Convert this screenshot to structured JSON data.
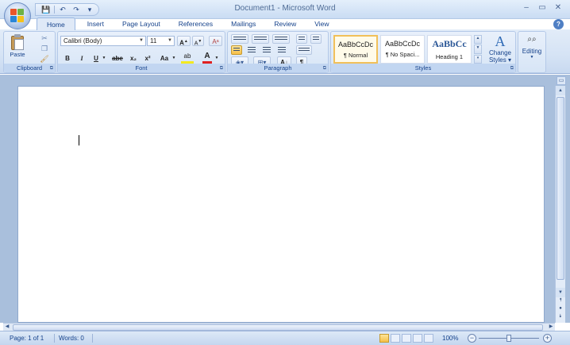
{
  "window": {
    "title": "Document1 - Microsoft Word"
  },
  "qat": {
    "save": "💾",
    "undo": "↶",
    "redo": "↷",
    "more": "▾"
  },
  "window_controls": {
    "minimize": "–",
    "restore": "▭",
    "close": "✕"
  },
  "tabs": [
    "Home",
    "Insert",
    "Page Layout",
    "References",
    "Mailings",
    "Review",
    "View"
  ],
  "help_label": "?",
  "clipboard": {
    "paste_label": "Paste",
    "group_label": "Clipboard"
  },
  "font": {
    "name": "Calibri (Body)",
    "size": "11",
    "grow": "A",
    "shrink": "A",
    "clear": "Aᵃ",
    "bold": "B",
    "italic": "I",
    "underline": "U",
    "strike": "abe",
    "subscript": "x₂",
    "superscript": "x²",
    "case": "Aa",
    "highlight": "ab",
    "color": "A",
    "group_label": "Font"
  },
  "paragraph": {
    "sort": "A↓",
    "show_marks": "¶",
    "group_label": "Paragraph"
  },
  "styles": {
    "items": [
      {
        "sample": "AaBbCcDc",
        "name": "¶ Normal"
      },
      {
        "sample": "AaBbCcDc",
        "name": "¶ No Spaci..."
      },
      {
        "sample": "AaBbCc",
        "name": "Heading 1"
      }
    ],
    "change_label_1": "Change",
    "change_label_2": "Styles",
    "group_label": "Styles"
  },
  "editing": {
    "label": "Editing"
  },
  "status": {
    "page": "Page: 1 of 1",
    "words": "Words: 0",
    "zoom": "100%",
    "minus": "−",
    "plus": "+"
  },
  "colors": {
    "accent": "#15428b",
    "ribbon_bg": "#d5e3f5",
    "doc_bg": "#a9bfdc",
    "font_color_red": "#e02020",
    "highlight_yellow": "#f4ea20"
  }
}
